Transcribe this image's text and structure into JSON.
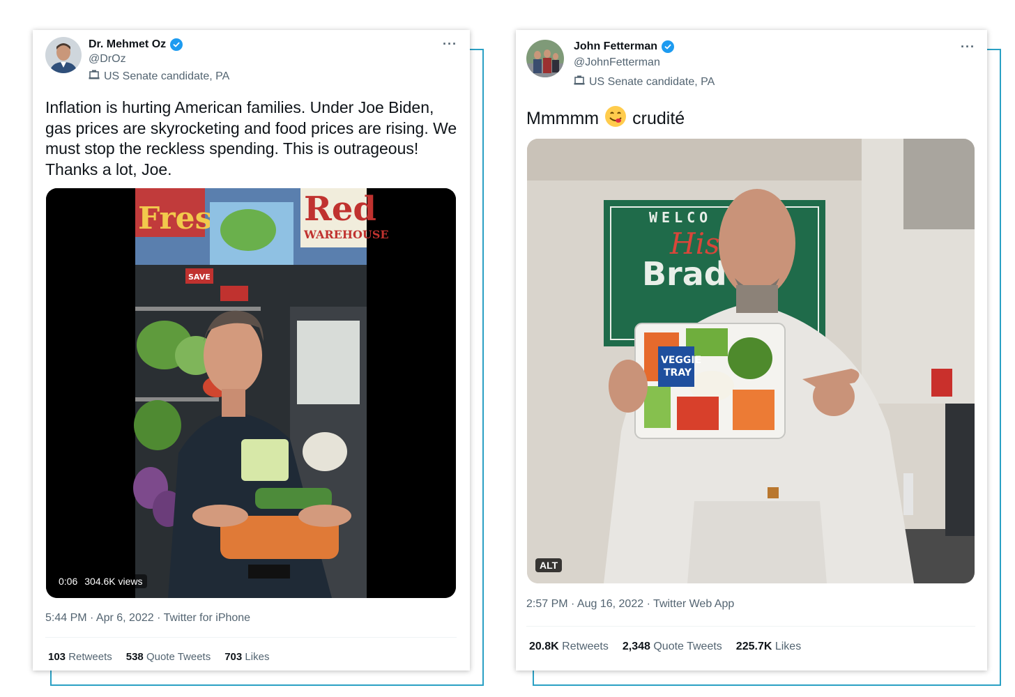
{
  "tweets": [
    {
      "author_name": "Dr. Mehmet Oz",
      "handle": "@DrOz",
      "label": "US Senate candidate, PA",
      "text": "Inflation is hurting American families. Under Joe Biden, gas prices are skyrocketing and food prices are rising. We must stop the reckless spending. This is outrageous! Thanks a lot, Joe.",
      "video_time": "0:06",
      "video_views": "304.6K views",
      "meta": "5:44 PM · Apr 6, 2022 · Twitter for iPhone",
      "retweets_count": "103",
      "retweets_label": "Retweets",
      "quotes_count": "538",
      "quotes_label": "Quote Tweets",
      "likes_count": "703",
      "likes_label": "Likes",
      "more": "···",
      "sign_words": [
        "Fresh F",
        "Red",
        "WAREHOUSE",
        "SAVE"
      ]
    },
    {
      "author_name": "John Fetterman",
      "handle": "@JohnFetterman",
      "label": "US Senate candidate, PA",
      "text_before": "Mmmmm",
      "text_emoji": "😋",
      "text_after": "crudité",
      "alt_badge": "ALT",
      "meta": "2:57 PM · Aug 16, 2022 · Twitter Web App",
      "retweets_count": "20.8K",
      "retweets_label": "Retweets",
      "quotes_count": "2,348",
      "quotes_label": "Quote Tweets",
      "likes_count": "225.7K",
      "likes_label": "Likes",
      "more": "···",
      "sign_words": [
        "WELCO",
        "Hist",
        "Brad",
        "VEGGIE",
        "TRAY"
      ]
    }
  ],
  "colors": {
    "accent_frame": "#2aa0c4",
    "verified": "#1d9bf0",
    "secondary_text": "#536471"
  },
  "icons": [
    "verified-badge-icon",
    "building-icon",
    "more-icon"
  ]
}
